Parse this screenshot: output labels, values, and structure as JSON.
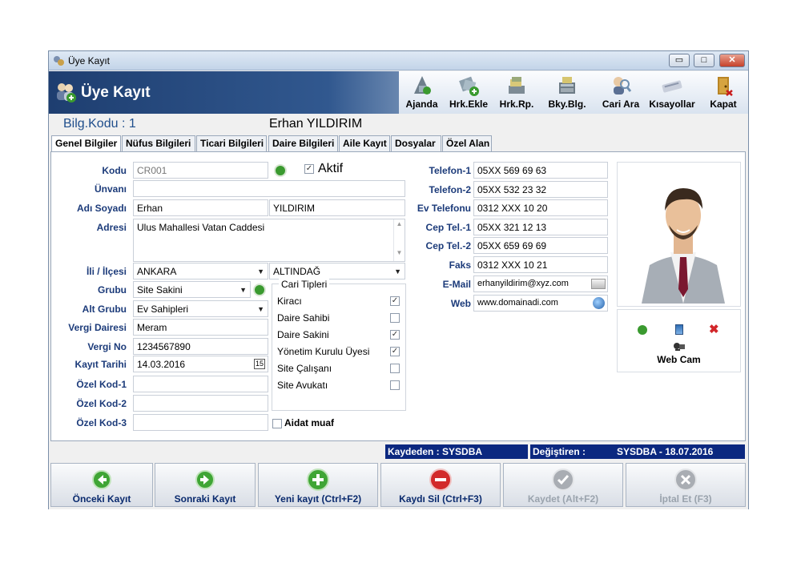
{
  "window": {
    "title": "Üye Kayıt",
    "minimize": "▭",
    "maximize": "□",
    "close": "✕"
  },
  "header": {
    "title": "Üye Kayıt"
  },
  "toolbar": [
    {
      "label": "Ajanda",
      "icon": "agenda-icon"
    },
    {
      "label": "Hrk.Ekle",
      "icon": "add-movement-icon"
    },
    {
      "label": "Hrk.Rp.",
      "icon": "movement-report-icon"
    },
    {
      "label": "Bky.Blg.",
      "icon": "balance-info-icon"
    },
    {
      "label": "Cari Ara",
      "icon": "search-account-icon"
    },
    {
      "label": "Kısayollar",
      "icon": "keyboard-shortcuts-icon"
    },
    {
      "label": "Kapat",
      "icon": "exit-door-icon"
    }
  ],
  "record": {
    "code_label": "Bilg.Kodu : 1",
    "name": "Erhan YILDIRIM"
  },
  "tabs": [
    "Genel Bilgiler",
    "Nüfus Bilgileri",
    "Ticari Bilgileri",
    "Daire Bilgileri",
    "Aile Kayıt",
    "Dosyalar",
    "Özel Alan"
  ],
  "form": {
    "kodu_label": "Kodu",
    "kodu": "CR001",
    "aktif_label": "Aktif",
    "unvani_label": "Ünvanı",
    "unvani": "",
    "adsoyad_label": "Adı Soyadı",
    "ad": "Erhan",
    "soyad": "YILDIRIM",
    "adres_label": "Adresi",
    "adres": "Ulus Mahallesi Vatan Caddesi",
    "il_label": "İli / İlçesi",
    "il": "ANKARA",
    "ilce": "ALTINDAĞ",
    "grubu_label": "Grubu",
    "grubu": "Site Sakini",
    "altgrubu_label": "Alt Grubu",
    "altgrubu": "Ev Sahipleri",
    "vergidaire_label": "Vergi Dairesi",
    "vergidaire": "Meram",
    "vergino_label": "Vergi No",
    "vergino": "1234567890",
    "kayittarihi_label": "Kayıt Tarihi",
    "kayittarihi": "14.03.2016",
    "calendar_day": "15",
    "ozelkod1_label": "Özel Kod-1",
    "ozelkod1": "",
    "ozelkod2_label": "Özel Kod-2",
    "ozelkod2": "",
    "ozelkod3_label": "Özel Kod-3",
    "ozelkod3": "",
    "aidat_label": "Aidat muaf"
  },
  "cari_tipleri": {
    "title": "Cari Tipleri",
    "items": [
      {
        "label": "Kiracı",
        "checked": true
      },
      {
        "label": "Daire Sahibi",
        "checked": false
      },
      {
        "label": "Daire Sakini",
        "checked": true
      },
      {
        "label": "Yönetim Kurulu Üyesi",
        "checked": true
      },
      {
        "label": "Site Çalışanı",
        "checked": false
      },
      {
        "label": "Site Avukatı",
        "checked": false
      }
    ]
  },
  "contact": [
    {
      "label": "Telefon-1",
      "value": "05XX 569 69 63"
    },
    {
      "label": "Telefon-2",
      "value": "05XX 532 23 32"
    },
    {
      "label": "Ev Telefonu",
      "value": "0312 XXX 10 20"
    },
    {
      "label": "Cep Tel.-1",
      "value": "05XX 321 12 13"
    },
    {
      "label": "Cep Tel.-2",
      "value": "05XX 659 69 69"
    },
    {
      "label": "Faks",
      "value": "0312 XXX 10 21"
    },
    {
      "label": "E-Mail",
      "value": "erhanyildirim@xyz.com"
    },
    {
      "label": "Web",
      "value": "www.domainadi.com"
    }
  ],
  "photo": {
    "webcam_label": "Web Cam"
  },
  "status": {
    "saved_by": "Kaydeden : SYSDBA",
    "changed_label": "Değiştiren :",
    "changed_value": "SYSDBA - 18.07.2016"
  },
  "buttons": [
    {
      "label": "Önceki Kayıt",
      "enabled": true
    },
    {
      "label": "Sonraki Kayıt",
      "enabled": true
    },
    {
      "label": "Yeni kayıt (Ctrl+F2)",
      "enabled": true
    },
    {
      "label": "Kaydı Sil (Ctrl+F3)",
      "enabled": true
    },
    {
      "label": "Kaydet (Alt+F2)",
      "enabled": false
    },
    {
      "label": "İptal Et (F3)",
      "enabled": false
    }
  ],
  "colors": {
    "accent": "#1f4e8c",
    "header_dark": "#1e3e70",
    "status_bar": "#0b2880",
    "label": "#1c3b7a",
    "green": "#3a9a2f",
    "red": "#c81c1c"
  }
}
